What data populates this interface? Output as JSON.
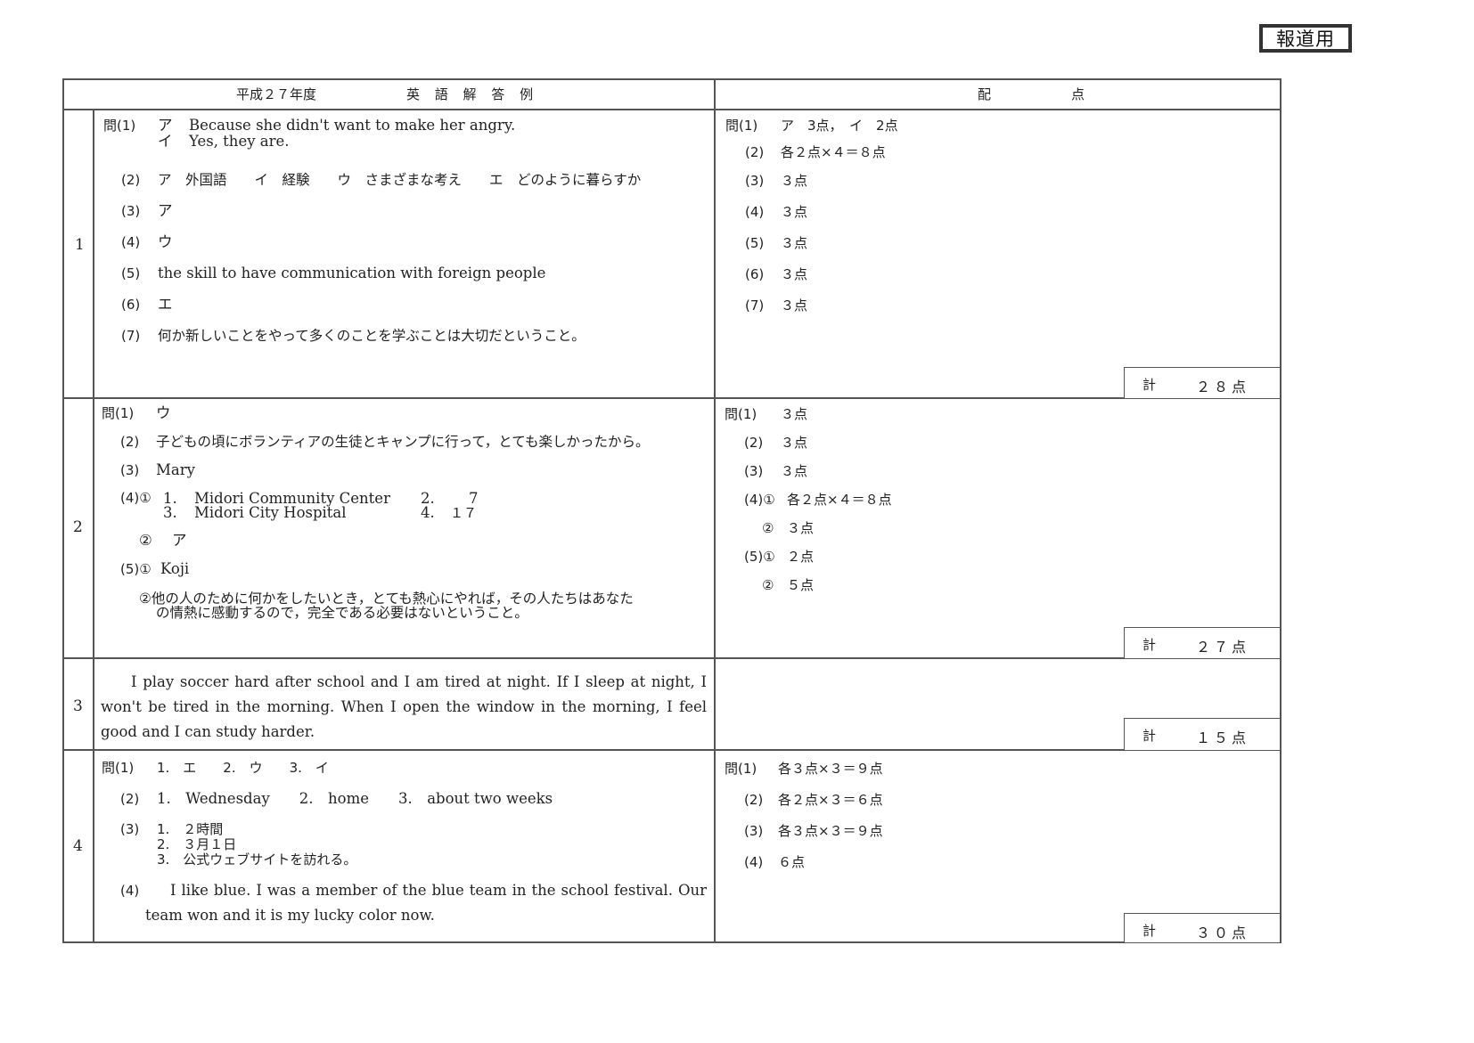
{
  "badge": "報道用",
  "header": {
    "year": "平成２７年度",
    "title": "英 語 解 答 例",
    "points_title": "配　　　　点"
  },
  "sections": [
    {
      "number": "1",
      "answers": {
        "q1_label": "問(1)",
        "q1_a_mark": "ア",
        "q1_a": "Because she didn't want to make her angry.",
        "q1_b_mark": "イ",
        "q1_b": "Yes, they are.",
        "q2_label": "(2)",
        "q2": "ア　外国語　　イ　経験　　ウ　さまざまな考え　　エ　どのように暮らすか",
        "q3_label": "(3)",
        "q3": "ア",
        "q4_label": "(4)",
        "q4": "ウ",
        "q5_label": "(5)",
        "q5": "the skill to have communication with foreign people",
        "q6_label": "(6)",
        "q6": "エ",
        "q7_label": "(7)",
        "q7": "何か新しいことをやって多くのことを学ぶことは大切だということ。"
      },
      "points": [
        {
          "label": "問(1)",
          "value": "ア　3点，　イ　2点"
        },
        {
          "label": "(2)",
          "value": "各２点×４＝８点"
        },
        {
          "label": "(3)",
          "value": "３点"
        },
        {
          "label": "(4)",
          "value": "３点"
        },
        {
          "label": "(5)",
          "value": "３点"
        },
        {
          "label": "(6)",
          "value": "３点"
        },
        {
          "label": "(7)",
          "value": "３点"
        }
      ],
      "total_label": "計",
      "total": "２８点"
    },
    {
      "number": "2",
      "answers": {
        "q1_label": "問(1)",
        "q1": "ウ",
        "q2_label": "(2)",
        "q2": "子どもの頃にボランティアの生徒とキャンプに行って，とても楽しかったから。",
        "q3_label": "(3)",
        "q3": "Mary",
        "q4_label": "(4)①",
        "q4_1_n": "1.",
        "q4_1": "Midori Community Center",
        "q4_2_n": "2.",
        "q4_2": "7",
        "q4_3_n": "3.",
        "q4_3": "Midori City Hospital",
        "q4_4_n": "4.",
        "q4_4": "１７",
        "q4b_label": "②",
        "q4b": "ア",
        "q5_label": "(5)①",
        "q5a": "Koji",
        "q5b_line1": "②他の人のために何かをしたいとき，とても熱心にやれば，その人たちはあなた",
        "q5b_line2": "の情熱に感動するので，完全である必要はないということ。"
      },
      "points": [
        {
          "label": "問(1)",
          "value": "３点"
        },
        {
          "label": "(2)",
          "value": "３点"
        },
        {
          "label": "(3)",
          "value": "３点"
        },
        {
          "label": "(4)①",
          "value": "各２点×４＝８点"
        },
        {
          "label": "②",
          "value": "３点"
        },
        {
          "label": "(5)①",
          "value": "２点"
        },
        {
          "label": "②",
          "value": "５点"
        }
      ],
      "total_label": "計",
      "total": "２７点"
    },
    {
      "number": "3",
      "answers": {
        "essay": "I play soccer hard after school and I am tired at night.  If I sleep at night, I won't be tired in the morning.  When I open the window in the morning, I feel good and I can study harder."
      },
      "points": [],
      "total_label": "計",
      "total": "１５点"
    },
    {
      "number": "4",
      "answers": {
        "q1_label": "問(1)",
        "q1": "1.　エ　　2.　ウ　　3.　イ",
        "q2_label": "(2)",
        "q2": "1.　Wednesday　　2.　home　　3.　about two weeks",
        "q3_label": "(3)",
        "q3_1": "1.　２時間",
        "q3_2": "2.　３月１日",
        "q3_3": "3.　公式ウェブサイトを訪れる。",
        "q4_label": "(4)",
        "q4": "I like blue.  I was a member of the blue team in the school festival.  Our team won and it is my lucky color now."
      },
      "points": [
        {
          "label": "問(1)",
          "value": "各３点×３＝９点"
        },
        {
          "label": "(2)",
          "value": "各２点×３＝６点"
        },
        {
          "label": "(3)",
          "value": "各３点×３＝９点"
        },
        {
          "label": "(4)",
          "value": "６点"
        }
      ],
      "total_label": "計",
      "total": "３０点"
    }
  ]
}
